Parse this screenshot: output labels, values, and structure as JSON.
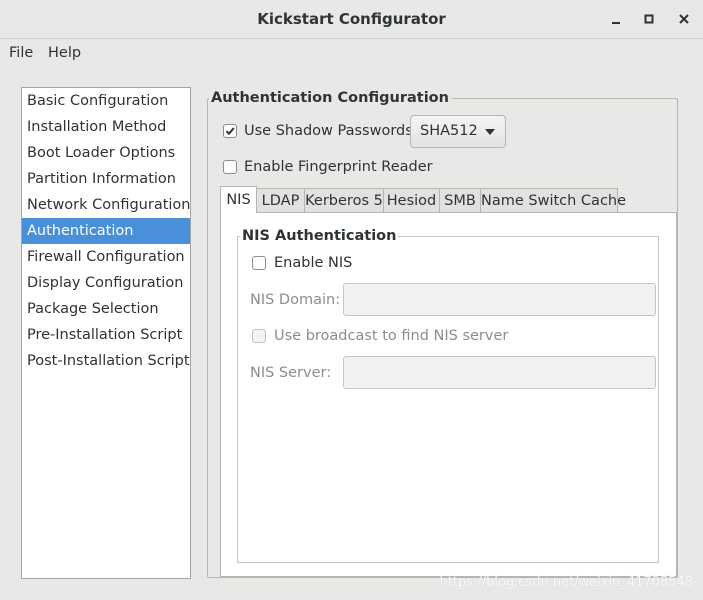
{
  "window": {
    "title": "Kickstart Configurator"
  },
  "menubar": {
    "items": [
      "File",
      "Help"
    ]
  },
  "sidebar": {
    "items": [
      "Basic Configuration",
      "Installation Method",
      "Boot Loader Options",
      "Partition Information",
      "Network Configuration",
      "Authentication",
      "Firewall Configuration",
      "Display Configuration",
      "Package Selection",
      "Pre-Installation Script",
      "Post-Installation Script"
    ],
    "selected": "Authentication"
  },
  "auth": {
    "frame_label": "Authentication Configuration",
    "shadow_passwords": {
      "label": "Use Shadow Passwords",
      "checked": true
    },
    "hash_algorithm": {
      "value": "SHA512"
    },
    "fingerprint": {
      "label": "Enable Fingerprint Reader",
      "checked": false
    }
  },
  "tabs": {
    "items": [
      "NIS",
      "LDAP",
      "Kerberos 5",
      "Hesiod",
      "SMB",
      "Name Switch Cache"
    ],
    "active": "NIS"
  },
  "nis": {
    "frame_label": "NIS Authentication",
    "enable": {
      "label": "Enable NIS",
      "checked": false
    },
    "domain_label": "NIS Domain:",
    "domain_value": "",
    "broadcast": {
      "label": "Use broadcast to find NIS server",
      "checked": false,
      "enabled": false
    },
    "server_label": "NIS Server:",
    "server_value": ""
  },
  "watermark": "https://blog.csdn.net/weixin_41708548",
  "colors": {
    "selection": "#4a90d9",
    "window_bg": "#e8e8e7"
  }
}
